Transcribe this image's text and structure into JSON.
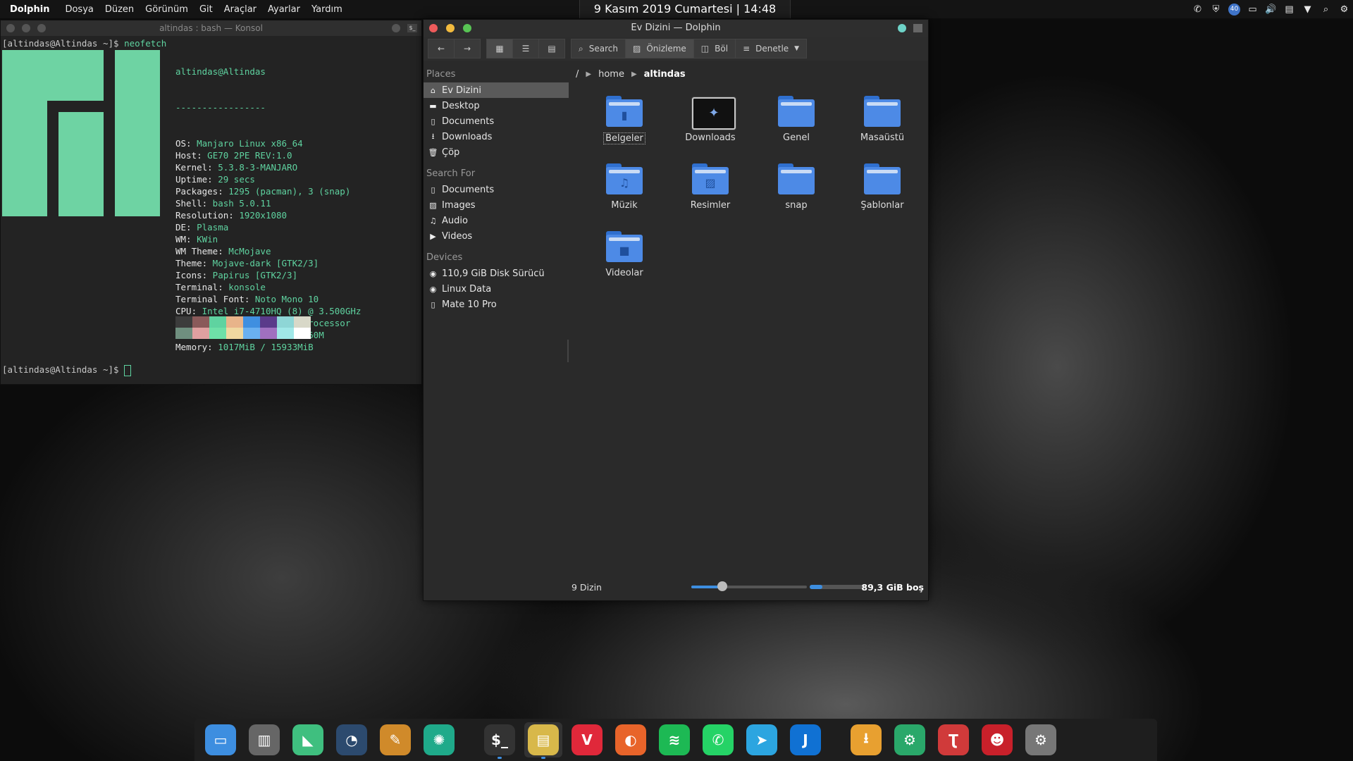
{
  "topbar": {
    "app_name": "Dolphin",
    "menu": [
      "Dosya",
      "Düzen",
      "Görünüm",
      "Git",
      "Araçlar",
      "Ayarlar",
      "Yardım"
    ],
    "clock": "9 Kasım 2019 Cumartesi | 14:48",
    "tray": {
      "badge": "40",
      "icons": [
        "whatsapp-icon",
        "shield-icon",
        "badge-icon",
        "display-icon",
        "volume-icon",
        "clipboard-icon",
        "arrow-down-icon",
        "search-icon",
        "settings-icon"
      ]
    }
  },
  "konsole": {
    "title": "altindas : bash — Konsol",
    "prompt1": "[altindas@Altindas ~]$ ",
    "command": "neofetch",
    "prompt2": "[altindas@Altindas ~]$ ",
    "header": "altindas@Altindas",
    "rule": "-----------------",
    "info": [
      {
        "k": "OS:",
        "v": " Manjaro Linux x86_64"
      },
      {
        "k": "Host:",
        "v": " GE70 2PE REV:1.0"
      },
      {
        "k": "Kernel:",
        "v": " 5.3.8-3-MANJARO"
      },
      {
        "k": "Uptime:",
        "v": " 29 secs"
      },
      {
        "k": "Packages:",
        "v": " 1295 (pacman), 3 (snap)"
      },
      {
        "k": "Shell:",
        "v": " bash 5.0.11"
      },
      {
        "k": "Resolution:",
        "v": " 1920x1080"
      },
      {
        "k": "DE:",
        "v": " Plasma"
      },
      {
        "k": "WM:",
        "v": " KWin"
      },
      {
        "k": "WM Theme:",
        "v": " McMojave"
      },
      {
        "k": "Theme:",
        "v": " Mojave-dark [GTK2/3]"
      },
      {
        "k": "Icons:",
        "v": " Papirus [GTK2/3]"
      },
      {
        "k": "Terminal:",
        "v": " konsole"
      },
      {
        "k": "Terminal Font:",
        "v": " Noto Mono 10"
      },
      {
        "k": "CPU:",
        "v": " Intel i7-4710HQ (8) @ 3.500GHz"
      },
      {
        "k": "GPU:",
        "v": " Intel 4th Gen Core Processor"
      },
      {
        "k": "GPU:",
        "v": " NVIDIA GeForce GTX 860M"
      },
      {
        "k": "Memory:",
        "v": " 1017MiB / 15933MiB"
      }
    ],
    "swatches_top": [
      "#3c3c3c",
      "#8a5a5a",
      "#5fd3a0",
      "#e8b48a",
      "#3f8fe0",
      "#5a3a8a",
      "#8ed6d6",
      "#d8d8c8"
    ],
    "swatches_bottom": [
      "#6f8f7f",
      "#e0a0a0",
      "#6ee0a8",
      "#f0d8a0",
      "#6ab0f0",
      "#a070c0",
      "#a0e8e8",
      "#ffffff"
    ]
  },
  "dolphin": {
    "title": "Ev Dizini — Dolphin",
    "toolbar": {
      "search": "Search",
      "preview": "Önizleme",
      "split": "Böl",
      "control": "Denetle"
    },
    "places_head": "Places",
    "places": [
      {
        "label": "Ev Dizini",
        "icon": "home-icon",
        "glyph": "⌂",
        "active": true
      },
      {
        "label": "Desktop",
        "icon": "desktop-icon",
        "glyph": "▬"
      },
      {
        "label": "Documents",
        "icon": "document-icon",
        "glyph": "▯"
      },
      {
        "label": "Downloads",
        "icon": "download-icon",
        "glyph": "⭳"
      },
      {
        "label": "Çöp",
        "icon": "trash-icon",
        "glyph": "🗑"
      }
    ],
    "search_head": "Search For",
    "search_for": [
      {
        "label": "Documents",
        "icon": "document-icon",
        "glyph": "▯"
      },
      {
        "label": "Images",
        "icon": "image-icon",
        "glyph": "▨"
      },
      {
        "label": "Audio",
        "icon": "music-icon",
        "glyph": "♫"
      },
      {
        "label": "Videos",
        "icon": "video-icon",
        "glyph": "▶"
      }
    ],
    "devices_head": "Devices",
    "devices": [
      {
        "label": "110,9 GiB Disk Sürücü",
        "icon": "drive-icon",
        "glyph": "◉"
      },
      {
        "label": "Linux Data",
        "icon": "drive-icon",
        "glyph": "◉"
      },
      {
        "label": "Mate 10 Pro",
        "icon": "phone-icon",
        "glyph": "▯"
      }
    ],
    "breadcrumb": {
      "root": "/",
      "home": "home",
      "current": "altindas"
    },
    "folders": [
      {
        "label": "Belgeler",
        "glyph": "▮",
        "focus": true
      },
      {
        "label": "Downloads",
        "glyph": "⭳",
        "special": true
      },
      {
        "label": "Genel",
        "glyph": ""
      },
      {
        "label": "Masaüstü",
        "glyph": ""
      },
      {
        "label": "Müzik",
        "glyph": "♫"
      },
      {
        "label": "Resimler",
        "glyph": "▨"
      },
      {
        "label": "snap",
        "glyph": ""
      },
      {
        "label": "Şablonlar",
        "glyph": ""
      },
      {
        "label": "Videolar",
        "glyph": "■"
      }
    ],
    "status": {
      "count": "9 Dizin",
      "free": "89,3 GiB boş",
      "zoom_fraction": 0.27,
      "used_fraction": 0.22
    }
  },
  "dock": [
    {
      "name": "finder-icon",
      "color": "#3d8ee0",
      "glyph": "▭"
    },
    {
      "name": "trash-icon",
      "color": "#666",
      "glyph": "▥"
    },
    {
      "name": "monitor-icon",
      "color": "#3fbf7f",
      "glyph": "◣"
    },
    {
      "name": "gauge-icon",
      "color": "#2c4a6e",
      "glyph": "◔"
    },
    {
      "name": "cleaner-icon",
      "color": "#d08a2a",
      "glyph": "✎"
    },
    {
      "name": "aperture-icon",
      "color": "#1faa8a",
      "glyph": "✺"
    },
    {
      "sep": true
    },
    {
      "name": "terminal-icon",
      "color": "#333",
      "glyph": "$_",
      "run": true
    },
    {
      "name": "files-icon",
      "color": "#d8b84a",
      "glyph": "▤",
      "run": true,
      "active": true
    },
    {
      "name": "vivaldi-icon",
      "color": "#e0283a",
      "glyph": "V"
    },
    {
      "name": "firefox-icon",
      "color": "#e8642a",
      "glyph": "◐"
    },
    {
      "name": "spotify-icon",
      "color": "#1db954",
      "glyph": "≋"
    },
    {
      "name": "whatsapp-icon",
      "color": "#25d366",
      "glyph": "✆"
    },
    {
      "name": "telegram-icon",
      "color": "#2ca5e0",
      "glyph": "➤"
    },
    {
      "name": "joplin-icon",
      "color": "#1071d3",
      "glyph": "J"
    },
    {
      "sep": true
    },
    {
      "name": "downloader-icon",
      "color": "#e8a030",
      "glyph": "⭳"
    },
    {
      "name": "gear-plug-icon",
      "color": "#2aa86a",
      "glyph": "⚙"
    },
    {
      "name": "typora-icon",
      "color": "#d03a3a",
      "glyph": "Ʈ"
    },
    {
      "name": "devil-icon",
      "color": "#c8202a",
      "glyph": "☻"
    },
    {
      "name": "disk-settings-icon",
      "color": "#777",
      "glyph": "⚙"
    }
  ]
}
